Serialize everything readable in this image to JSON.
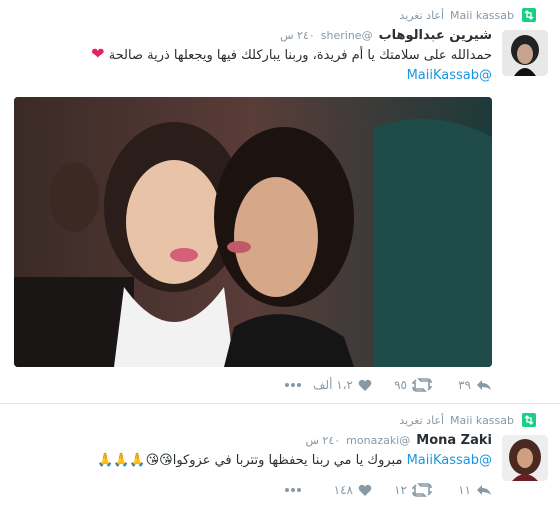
{
  "tweets": [
    {
      "retweeted_by": "Maii kassab",
      "retweet_label": "أعاد تغريد",
      "name": "شيرين عبدالوهاب",
      "handle": "@sherine",
      "time": "٢٤٠ س",
      "text": "حمدالله على سلامتك يا أم فريدة، وربنا يباركلك فيها ويجعلها ذرية صالحة",
      "mention": "@MaiiKassab",
      "actions": {
        "reply": "٣٩",
        "retweet": "٩٥",
        "like": "١،٢ ألف"
      }
    },
    {
      "retweeted_by": "Maii kassab",
      "retweet_label": "أعاد تغريد",
      "name": "Mona Zaki",
      "handle": "@monazaki",
      "time": "٢٤٠ س",
      "mention": "@MaiiKassab",
      "text": "مبروك يا مي ربنا يحفظها وتتربا في عزوكوا",
      "emoji": "😘😘🙏🙏🙏",
      "actions": {
        "reply": "١١",
        "retweet": "١٢",
        "like": "١٤٨"
      }
    }
  ],
  "colors": {
    "retweet_green": "#19cf86",
    "link_blue": "#1b95e0",
    "heart_red": "#e0245e",
    "muted": "#8899a6"
  }
}
